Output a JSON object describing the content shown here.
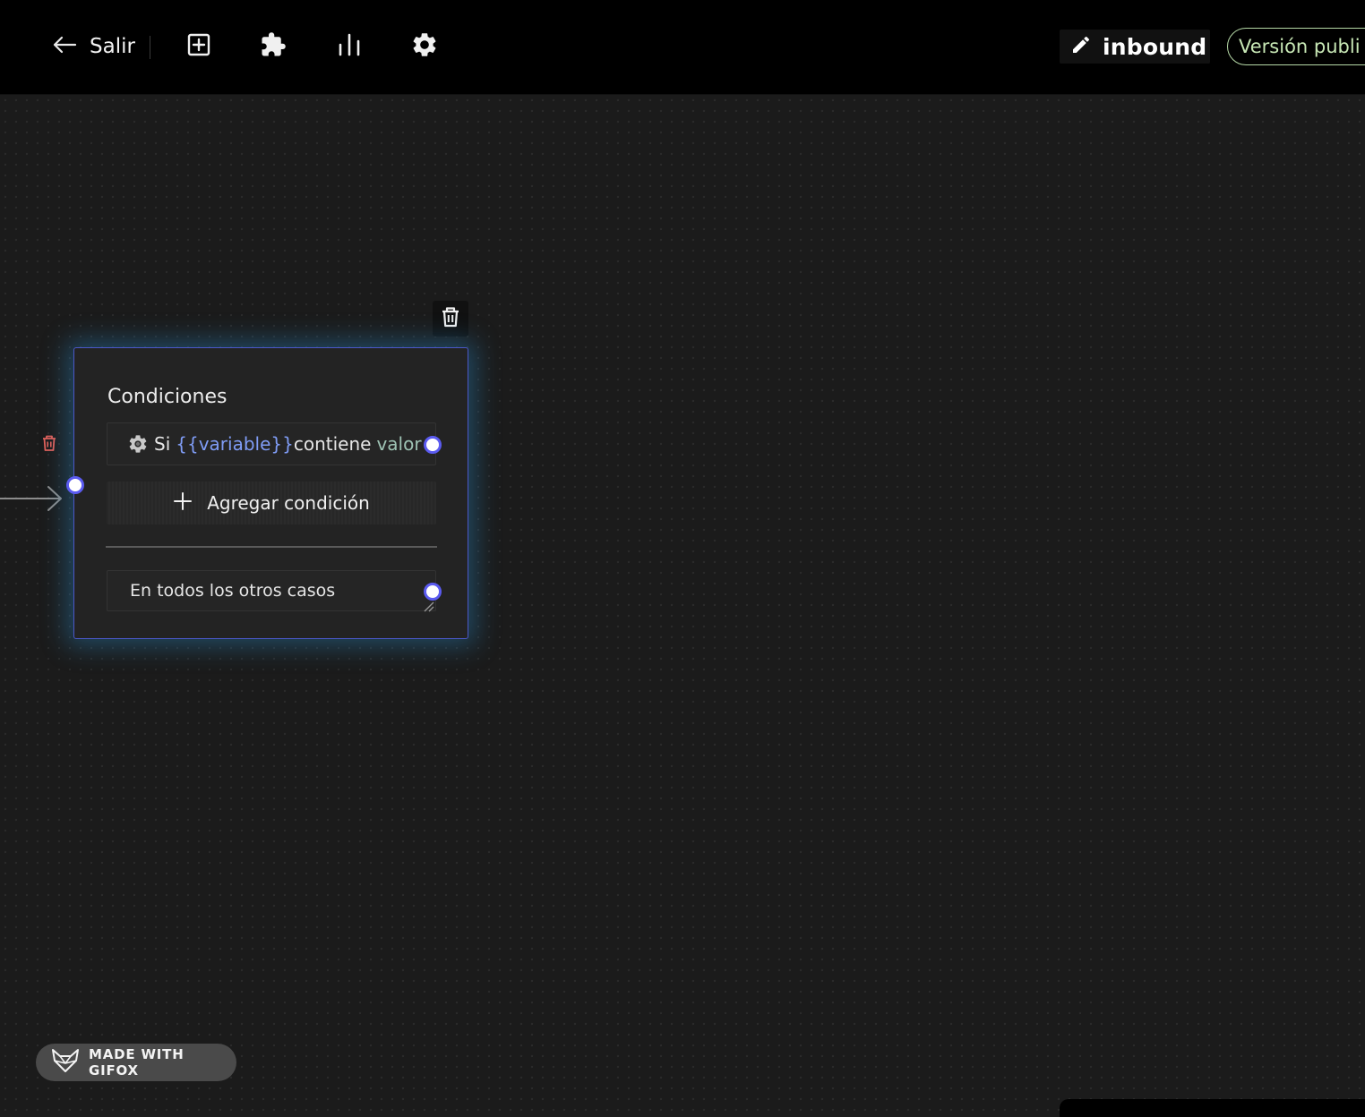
{
  "toolbar": {
    "back_label": "Salir",
    "icons": [
      "arrow-left-icon",
      "add-block-icon",
      "puzzle-icon",
      "bar-chart-icon",
      "gear-icon"
    ],
    "flow_name": "inbound",
    "version_label": "Versión publi"
  },
  "node": {
    "title": "Condiciones",
    "condition": {
      "prefix": "Si",
      "variable": "{{variable}}",
      "operator": "contiene",
      "value": "valor"
    },
    "add_label": "Agregar condición",
    "else_label": "En todos los otros casos"
  },
  "badge": {
    "label": "MADE WITH GIFOX"
  },
  "colors": {
    "accent": "#5b5bf0",
    "variable": "#7f9cf5",
    "value": "#9ec3b4",
    "version_border": "#b5d8a6",
    "glow": "#2989c4",
    "trash_red": "#e0605a"
  }
}
